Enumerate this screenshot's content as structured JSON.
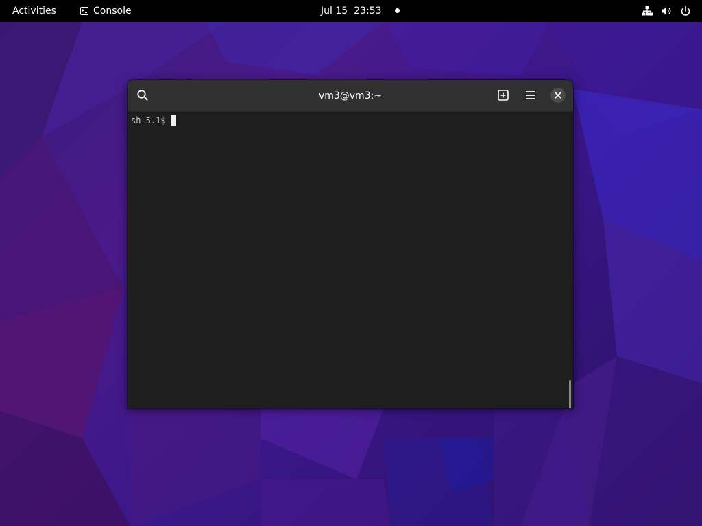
{
  "topbar": {
    "activities_label": "Activities",
    "app_name": "Console",
    "date": "Jul 15",
    "time": "23:53",
    "icons": [
      "network-icon",
      "volume-icon",
      "power-icon"
    ]
  },
  "window": {
    "title": "vm3@vm3:~",
    "header_icons": [
      "search-icon",
      "new-tab-icon",
      "hamburger-menu-icon",
      "close-icon"
    ]
  },
  "terminal": {
    "prompt": "sh-5.1$"
  },
  "colors": {
    "topbar_bg": "#000000",
    "window_bg": "#1e1e1e",
    "headerbar_bg": "#303030",
    "wallpaper_primary": "#4a1a8a"
  }
}
